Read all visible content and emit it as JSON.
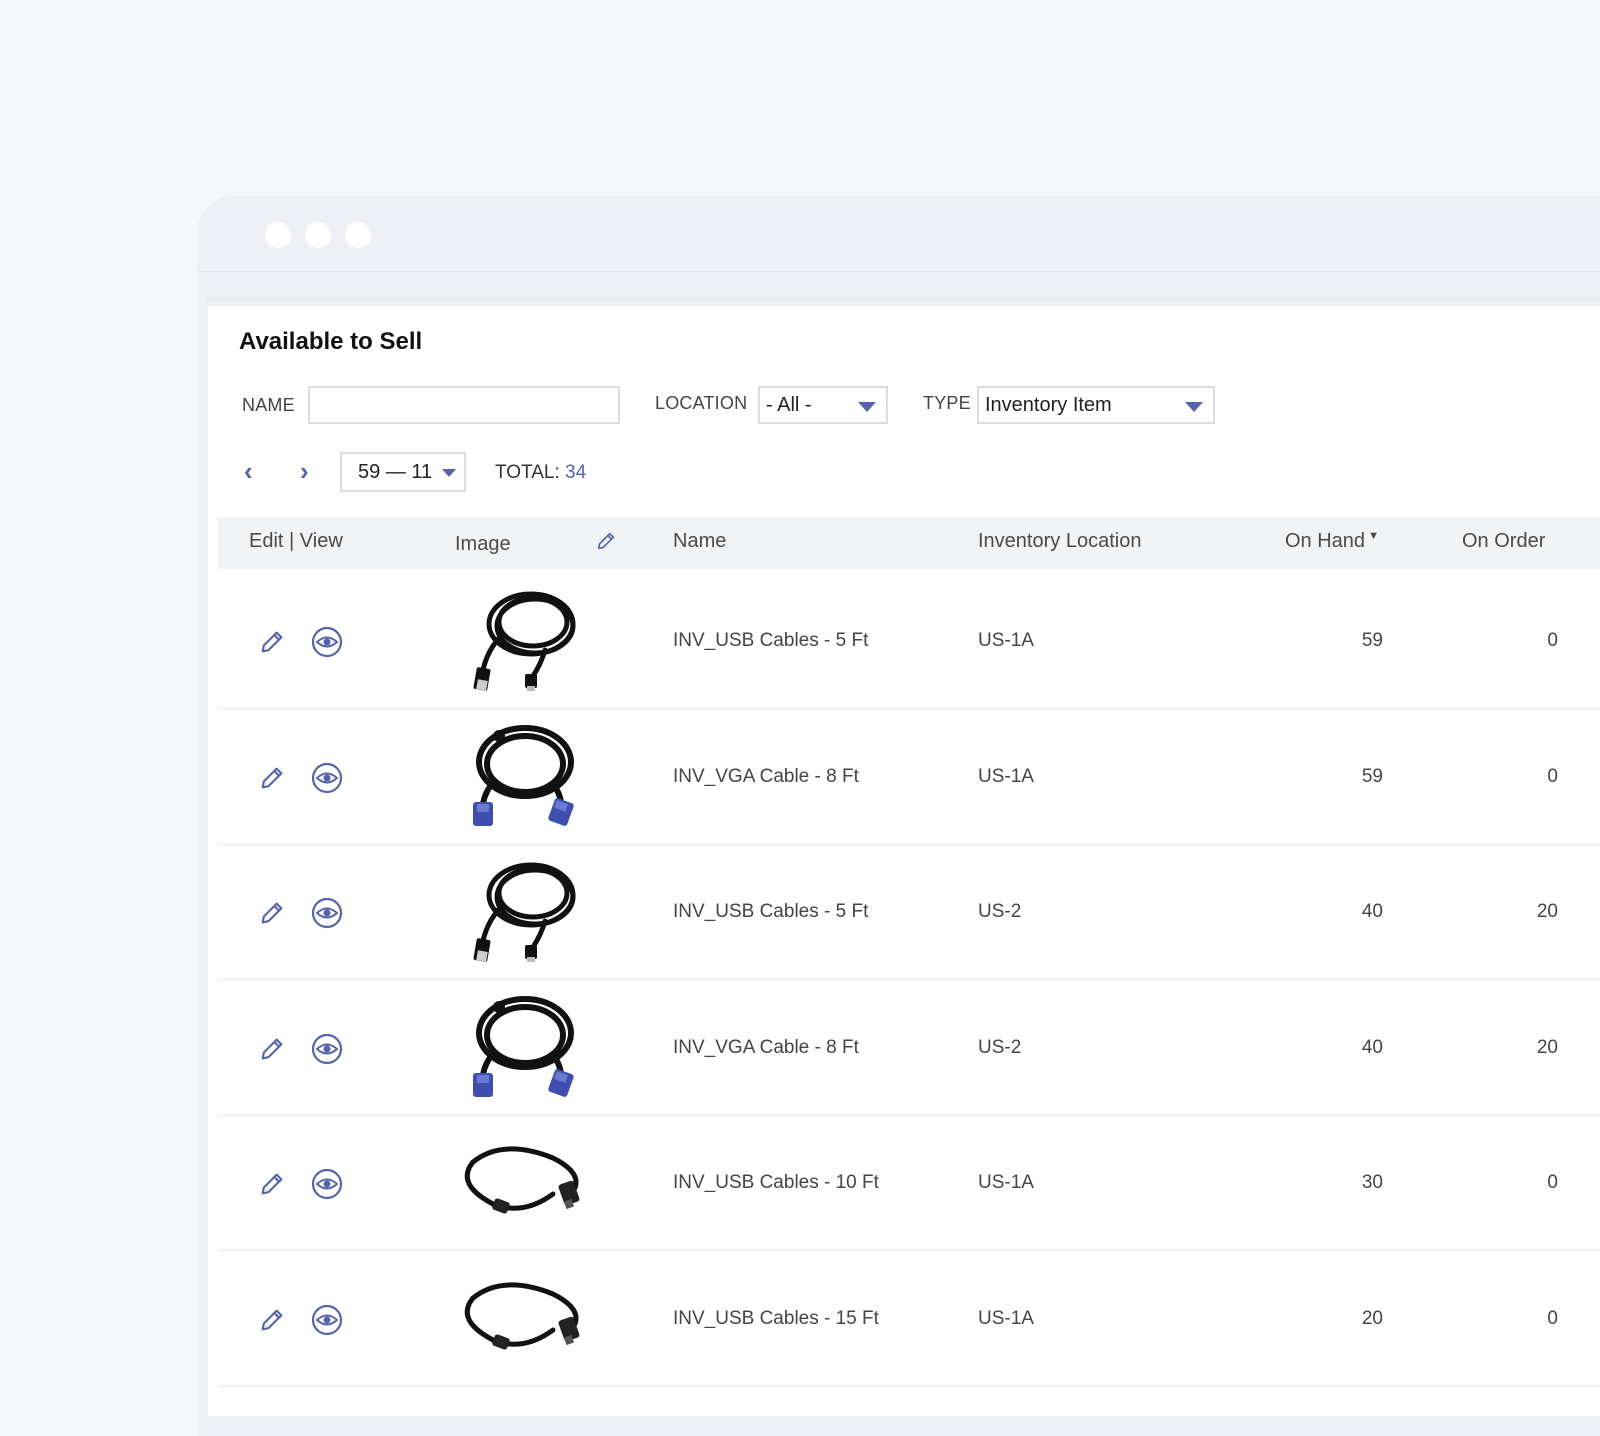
{
  "window": {
    "dots": 3
  },
  "page": {
    "title": "Available to Sell"
  },
  "filters": {
    "name_label": "NAME",
    "name_value": "",
    "location_label": "LOCATION",
    "location_value": "- All -",
    "type_label": "TYPE",
    "type_value": "Inventory Item"
  },
  "pager": {
    "prev_label": "‹",
    "next_label": "›",
    "range_value": "59 — 11",
    "total_label": "TOTAL:",
    "total_value": "34"
  },
  "table": {
    "headers": {
      "edit_view": "Edit | View",
      "image": "Image",
      "name": "Name",
      "location": "Inventory Location",
      "on_hand": "On Hand",
      "on_order": "On Order"
    },
    "rows": [
      {
        "name": "INV_USB Cables - 5 Ft",
        "location": "US-1A",
        "on_hand": "59",
        "on_order": "0",
        "image": "usb-coiled-cable"
      },
      {
        "name": "INV_VGA Cable - 8 Ft",
        "location": "US-1A",
        "on_hand": "59",
        "on_order": "0",
        "image": "vga-coiled-cable"
      },
      {
        "name": "INV_USB Cables - 5 Ft",
        "location": "US-2",
        "on_hand": "40",
        "on_order": "20",
        "image": "usb-coiled-cable"
      },
      {
        "name": "INV_VGA Cable - 8 Ft",
        "location": "US-2",
        "on_hand": "40",
        "on_order": "20",
        "image": "vga-coiled-cable"
      },
      {
        "name": "INV_USB Cables - 10 Ft",
        "location": "US-1A",
        "on_hand": "30",
        "on_order": "0",
        "image": "usb-loop-cable"
      },
      {
        "name": "INV_USB Cables - 15 Ft",
        "location": "US-1A",
        "on_hand": "20",
        "on_order": "0",
        "image": "usb-loop-cable"
      }
    ]
  },
  "colors": {
    "accent": "#5563a8",
    "vga_connector": "#3f4fae",
    "header_bg": "#f2f3f5"
  }
}
